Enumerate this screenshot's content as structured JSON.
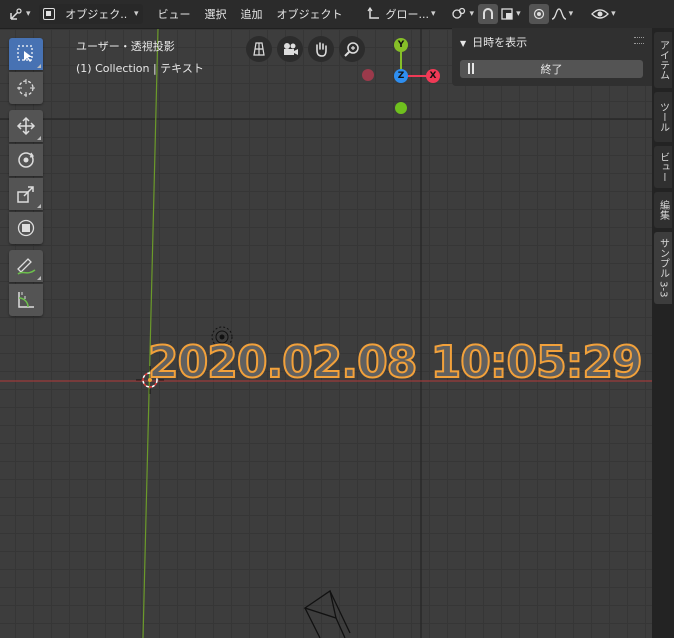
{
  "header": {
    "mode_select": "オブジェク..",
    "menus": [
      "ビュー",
      "選択",
      "追加",
      "オブジェクト"
    ],
    "transform_orientation": "グロー..."
  },
  "overlay": {
    "view_name": "ユーザー・透視投影",
    "collection_info": "(1) Collection | テキスト"
  },
  "gizmo": {
    "y_label": "Y",
    "z_label": "Z",
    "x_label": "X"
  },
  "panel": {
    "title": "日時を表示",
    "stop_button": "終了"
  },
  "tabs": [
    "アイテム",
    "ツール",
    "ビュー",
    "編集",
    "サンプル 3-3"
  ],
  "text_object": "2020.02.08 10:05:29",
  "colors": {
    "accent": "#4772b3",
    "axis_x": "#f03a56",
    "axis_y": "#86bf28",
    "axis_z": "#2e8ef0",
    "text_outline": "#f2a13b"
  }
}
